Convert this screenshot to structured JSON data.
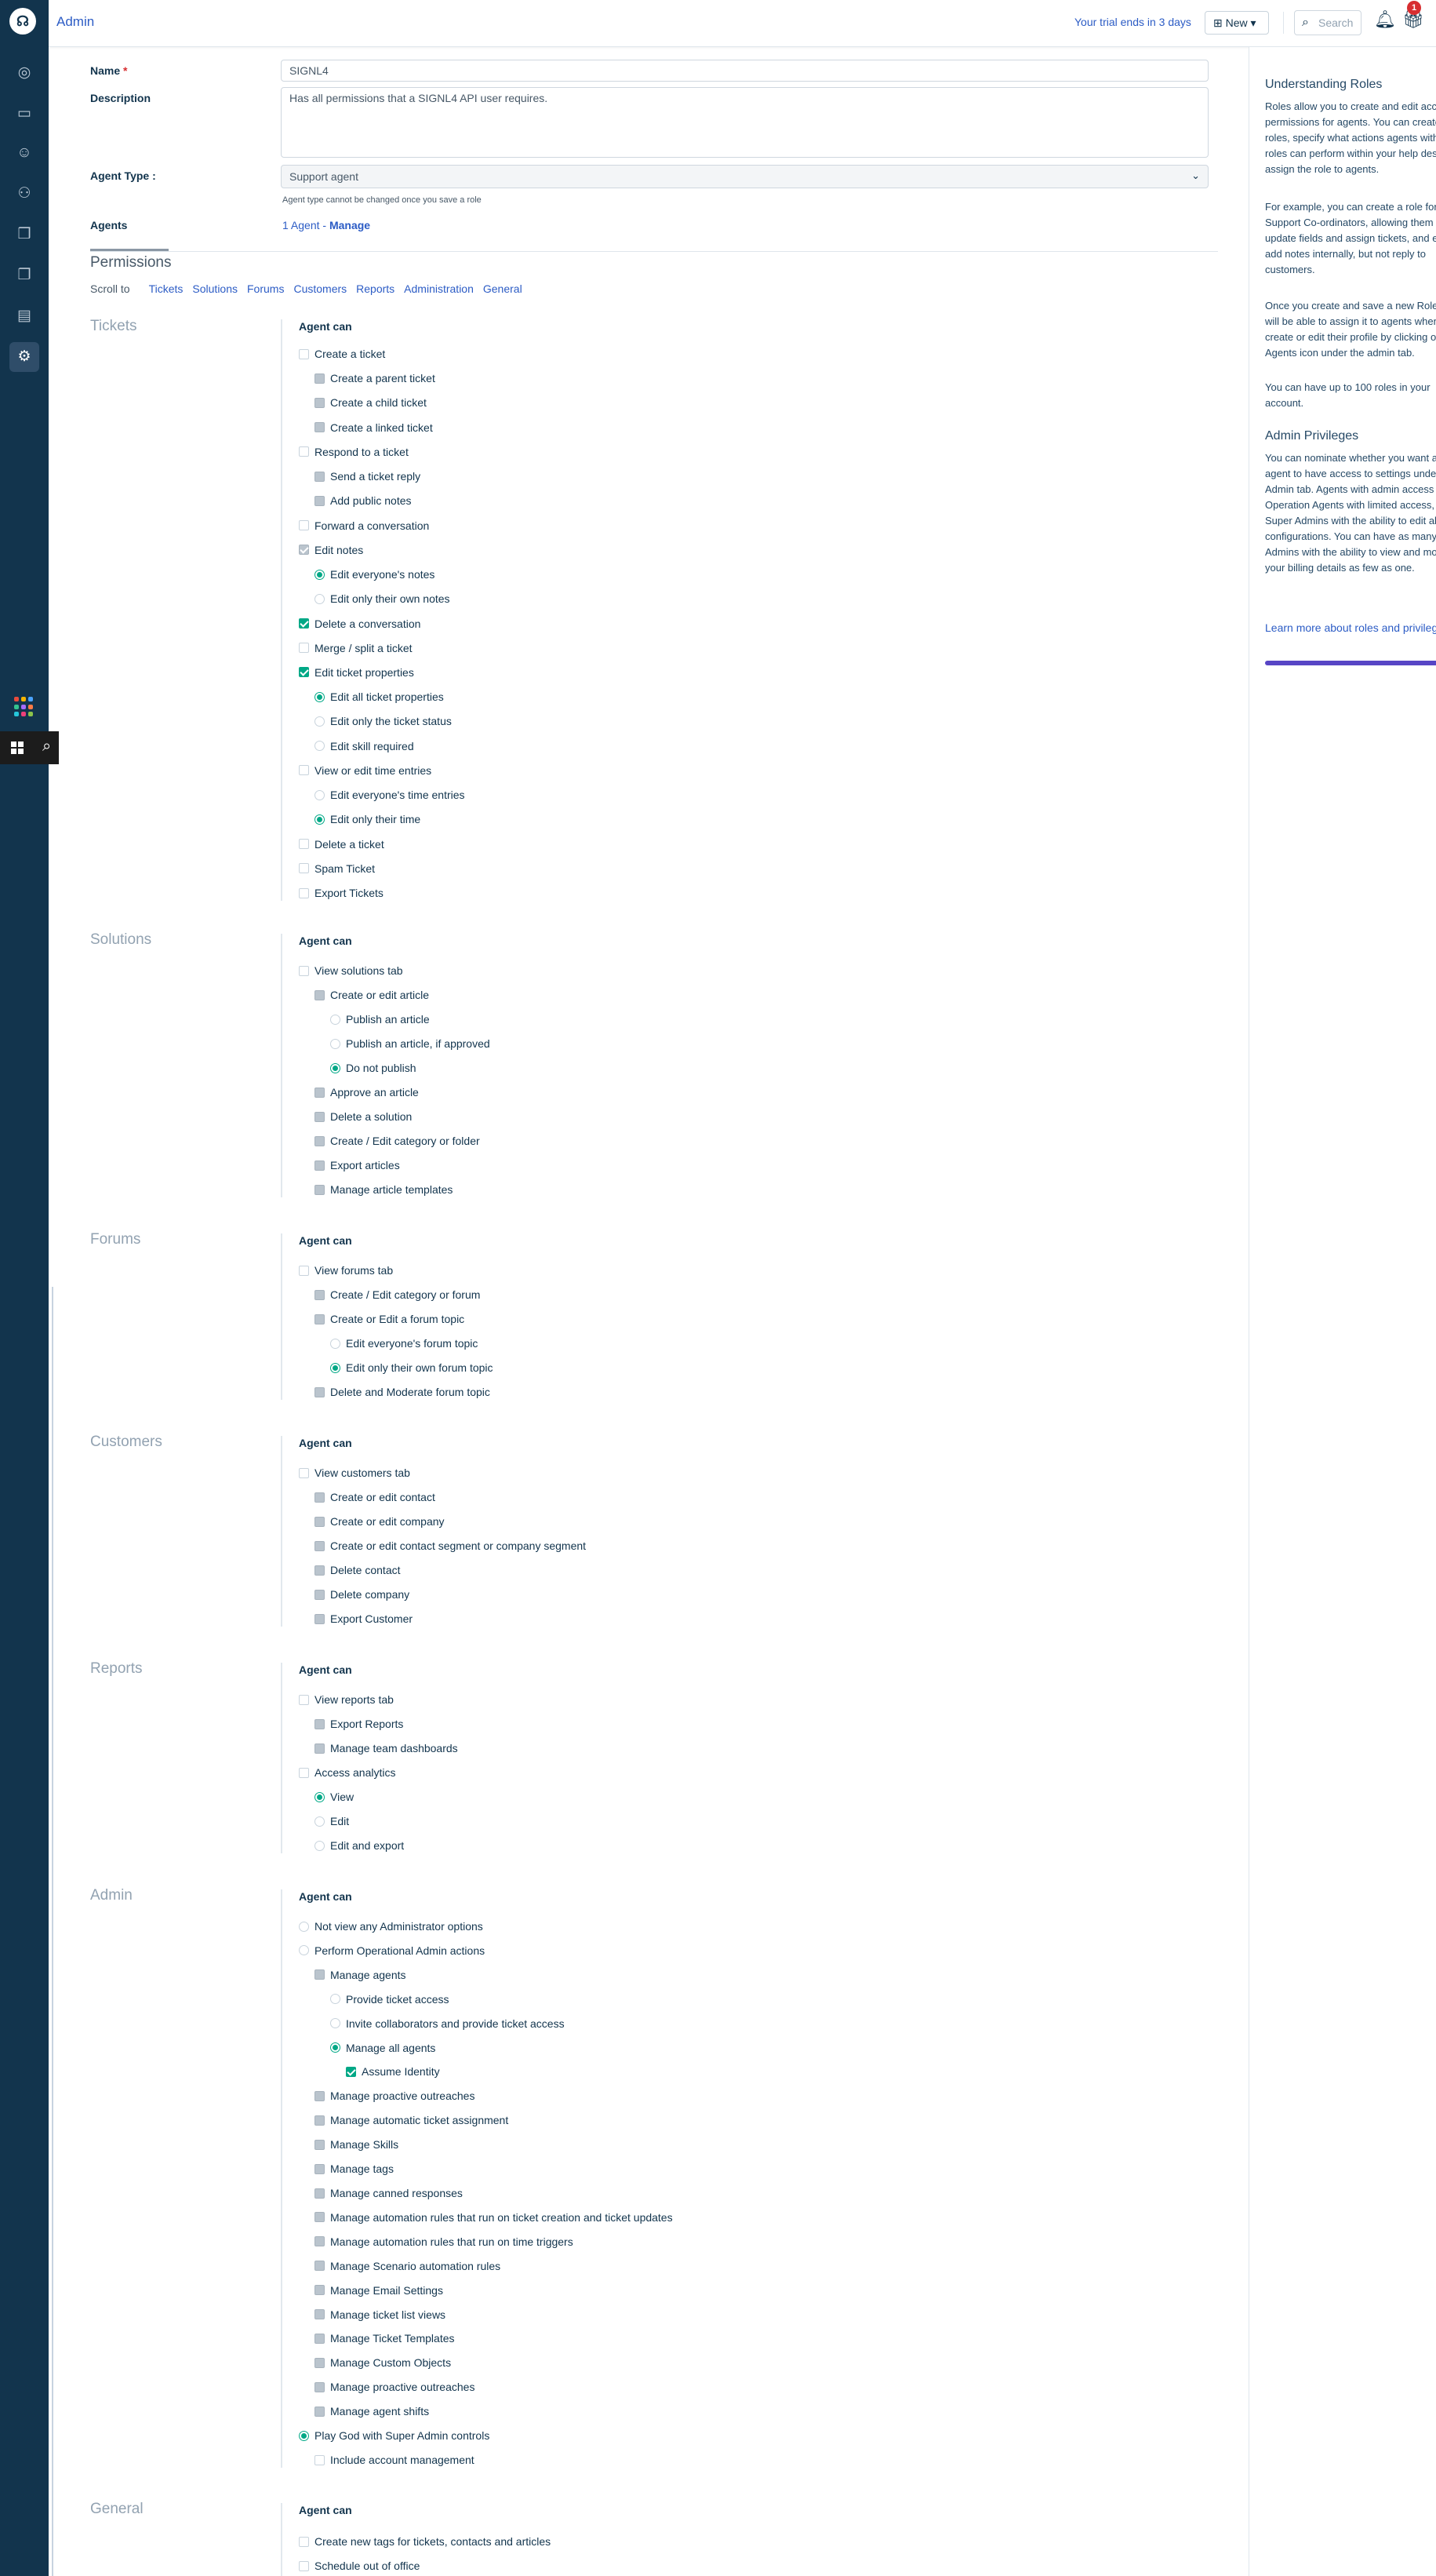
{
  "app": {
    "title": "Admin",
    "trial": "Your trial ends in 3 days",
    "new_label": "New",
    "search_placeholder": "Search",
    "notification_count": "1"
  },
  "nav": {
    "icons": [
      "dashboard-icon",
      "tickets-icon",
      "contacts-icon",
      "social-icon",
      "solutions-icon",
      "forums-icon",
      "reports-icon",
      "admin-icon"
    ]
  },
  "form": {
    "name_label": "Name",
    "name_value": "SIGNL4",
    "description_label": "Description",
    "description_value": "Has all permissions that a SIGNL4 API user requires.",
    "agent_type_label": "Agent Type",
    "agent_type_value": "Support agent",
    "agent_type_hint": "Agent type cannot be changed once you save a role",
    "agents_label": "Agents",
    "agents_count": "1 Agent",
    "agents_sep": " - ",
    "agents_manage": "Manage"
  },
  "permissions": {
    "title": "Permissions",
    "scroll_label": "Scroll to",
    "scroll_links": [
      "Tickets",
      "Solutions",
      "Forums",
      "Customers",
      "Reports",
      "Administration",
      "General"
    ],
    "agent_can": "Agent can",
    "sections": [
      {
        "key": "tickets",
        "title": "Tickets",
        "items": [
          {
            "t": "Create a ticket",
            "k": "cb",
            "l": 0
          },
          {
            "t": "Create a parent ticket",
            "k": "cbd",
            "l": 1
          },
          {
            "t": "Create a child ticket",
            "k": "cbd",
            "l": 1
          },
          {
            "t": "Create a linked ticket",
            "k": "cbd",
            "l": 1
          },
          {
            "t": "Respond to a ticket",
            "k": "cb",
            "l": 0
          },
          {
            "t": "Send a ticket reply",
            "k": "cbd",
            "l": 1
          },
          {
            "t": "Add public notes",
            "k": "cbd",
            "l": 1
          },
          {
            "t": "Forward a conversation",
            "k": "cb",
            "l": 0
          },
          {
            "t": "Edit notes",
            "k": "cbondis",
            "l": 0
          },
          {
            "t": "Edit everyone's notes",
            "k": "rdon",
            "l": 1
          },
          {
            "t": "Edit only their own notes",
            "k": "rd",
            "l": 1
          },
          {
            "t": "Delete a conversation",
            "k": "cbon",
            "l": 0
          },
          {
            "t": "Merge / split a ticket",
            "k": "cb",
            "l": 0
          },
          {
            "t": "Edit ticket properties",
            "k": "cbon",
            "l": 0
          },
          {
            "t": "Edit all ticket properties",
            "k": "rdon",
            "l": 1
          },
          {
            "t": "Edit only the ticket status",
            "k": "rd",
            "l": 1
          },
          {
            "t": "Edit skill required",
            "k": "rd",
            "l": 1
          },
          {
            "t": "View or edit time entries",
            "k": "cb",
            "l": 0
          },
          {
            "t": "Edit everyone's time entries",
            "k": "rd",
            "l": 1
          },
          {
            "t": "Edit only their time",
            "k": "rdon",
            "l": 1
          },
          {
            "t": "Delete a ticket",
            "k": "cb",
            "l": 0
          },
          {
            "t": "Spam Ticket",
            "k": "cb",
            "l": 0
          },
          {
            "t": "Export Tickets",
            "k": "cb",
            "l": 0
          }
        ]
      },
      {
        "key": "solutions",
        "title": "Solutions",
        "items": [
          {
            "t": "View solutions tab",
            "k": "cb",
            "l": 0
          },
          {
            "t": "Create or edit article",
            "k": "cbd",
            "l": 1
          },
          {
            "t": "Publish an article",
            "k": "rd",
            "l": 2
          },
          {
            "t": "Publish an article, if approved",
            "k": "rd",
            "l": 2
          },
          {
            "t": "Do not publish",
            "k": "rdon",
            "l": 2
          },
          {
            "t": "Approve an article",
            "k": "cbd",
            "l": 1
          },
          {
            "t": "Delete a solution",
            "k": "cbd",
            "l": 1
          },
          {
            "t": "Create / Edit category or folder",
            "k": "cbd",
            "l": 1
          },
          {
            "t": "Export articles",
            "k": "cbd",
            "l": 1
          },
          {
            "t": "Manage article templates",
            "k": "cbd",
            "l": 1
          }
        ]
      },
      {
        "key": "forums",
        "title": "Forums",
        "items": [
          {
            "t": "View forums tab",
            "k": "cb",
            "l": 0
          },
          {
            "t": "Create / Edit category or forum",
            "k": "cbd",
            "l": 1
          },
          {
            "t": "Create or Edit a forum topic",
            "k": "cbd",
            "l": 1
          },
          {
            "t": "Edit everyone's forum topic",
            "k": "rd",
            "l": 2
          },
          {
            "t": "Edit only their own forum topic",
            "k": "rdon",
            "l": 2
          },
          {
            "t": "Delete and Moderate forum topic",
            "k": "cbd",
            "l": 1
          }
        ]
      },
      {
        "key": "customers",
        "title": "Customers",
        "items": [
          {
            "t": "View customers tab",
            "k": "cb",
            "l": 0
          },
          {
            "t": "Create or edit contact",
            "k": "cbd",
            "l": 1
          },
          {
            "t": "Create or edit company",
            "k": "cbd",
            "l": 1
          },
          {
            "t": "Create or edit contact segment or company segment",
            "k": "cbd",
            "l": 1
          },
          {
            "t": "Delete contact",
            "k": "cbd",
            "l": 1
          },
          {
            "t": "Delete company",
            "k": "cbd",
            "l": 1
          },
          {
            "t": "Export Customer",
            "k": "cbd",
            "l": 1
          }
        ]
      },
      {
        "key": "reports",
        "title": "Reports",
        "items": [
          {
            "t": "View reports tab",
            "k": "cb",
            "l": 0
          },
          {
            "t": "Export Reports",
            "k": "cbd",
            "l": 1
          },
          {
            "t": "Manage team dashboards",
            "k": "cbd",
            "l": 1
          },
          {
            "t": "Access analytics",
            "k": "cb",
            "l": 0
          },
          {
            "t": "View",
            "k": "rdon",
            "l": 1
          },
          {
            "t": "Edit",
            "k": "rd",
            "l": 1
          },
          {
            "t": "Edit and export",
            "k": "rd",
            "l": 1
          }
        ]
      },
      {
        "key": "admin",
        "title": "Admin",
        "items": [
          {
            "t": "Not view any Administrator options",
            "k": "rd",
            "l": 0
          },
          {
            "t": "Perform Operational Admin actions",
            "k": "rd",
            "l": 0
          },
          {
            "t": "Manage agents",
            "k": "cbd",
            "l": 1
          },
          {
            "t": "Provide ticket access",
            "k": "rd",
            "l": 2
          },
          {
            "t": "Invite collaborators and provide ticket access",
            "k": "rd",
            "l": 2
          },
          {
            "t": "Manage all agents",
            "k": "rdon",
            "l": 2
          },
          {
            "t": "Assume Identity",
            "k": "cbon",
            "l": 3
          },
          {
            "t": "Manage proactive outreaches",
            "k": "cbd",
            "l": 1
          },
          {
            "t": "Manage automatic ticket assignment",
            "k": "cbd",
            "l": 1
          },
          {
            "t": "Manage Skills",
            "k": "cbd",
            "l": 1
          },
          {
            "t": "Manage tags",
            "k": "cbd",
            "l": 1
          },
          {
            "t": "Manage canned responses",
            "k": "cbd",
            "l": 1
          },
          {
            "t": "Manage automation rules that run on ticket creation and ticket updates",
            "k": "cbd",
            "l": 1
          },
          {
            "t": "Manage automation rules that run on time triggers",
            "k": "cbd",
            "l": 1
          },
          {
            "t": "Manage Scenario automation rules",
            "k": "cbd",
            "l": 1
          },
          {
            "t": "Manage Email Settings",
            "k": "cbd",
            "l": 1
          },
          {
            "t": "Manage ticket list views",
            "k": "cbd",
            "l": 1
          },
          {
            "t": "Manage Ticket Templates",
            "k": "cbd",
            "l": 1
          },
          {
            "t": "Manage Custom Objects",
            "k": "cbd",
            "l": 1
          },
          {
            "t": "Manage proactive outreaches",
            "k": "cbd",
            "l": 1
          },
          {
            "t": "Manage agent shifts",
            "k": "cbd",
            "l": 1
          },
          {
            "t": "Play God with Super Admin controls",
            "k": "rdon",
            "l": 0
          },
          {
            "t": "Include account management",
            "k": "cb",
            "l": 1
          }
        ]
      },
      {
        "key": "general",
        "title": "General",
        "items": [
          {
            "t": "Create new tags for tickets, contacts and articles",
            "k": "cb",
            "l": 0
          },
          {
            "t": "Schedule out of office",
            "k": "cb",
            "l": 0
          }
        ]
      }
    ]
  },
  "right_panel": {
    "roles_title": "Understanding Roles",
    "roles_p1": "Roles allow you to create and edit access permissions for agents. You can create new roles, specify what actions agents with these roles can perform within your help desk, and assign the role to agents.",
    "roles_p2": "For example, you can create a role for your Support Co-ordinators, allowing them to update fields and assign tickets, and even add notes internally, but not reply to customers.",
    "roles_p3": "Once you create and save a new Role you will be able to assign it to agents when you create or edit their profile by clicking on the Agents icon under the admin tab.",
    "roles_p4": "You can have up to 100 roles in your account.",
    "priv_title": "Admin Privileges",
    "priv_p1": "You can nominate whether you want an agent to have access to settings under the Admin tab. Agents with admin access can be Operation Agents with limited access, or Super Admins with the ability to edit all configurations. You can have as many Super Admins with the ability to view and modify your billing details as few as one.",
    "learn_more": "Learn more about roles and privileges"
  }
}
